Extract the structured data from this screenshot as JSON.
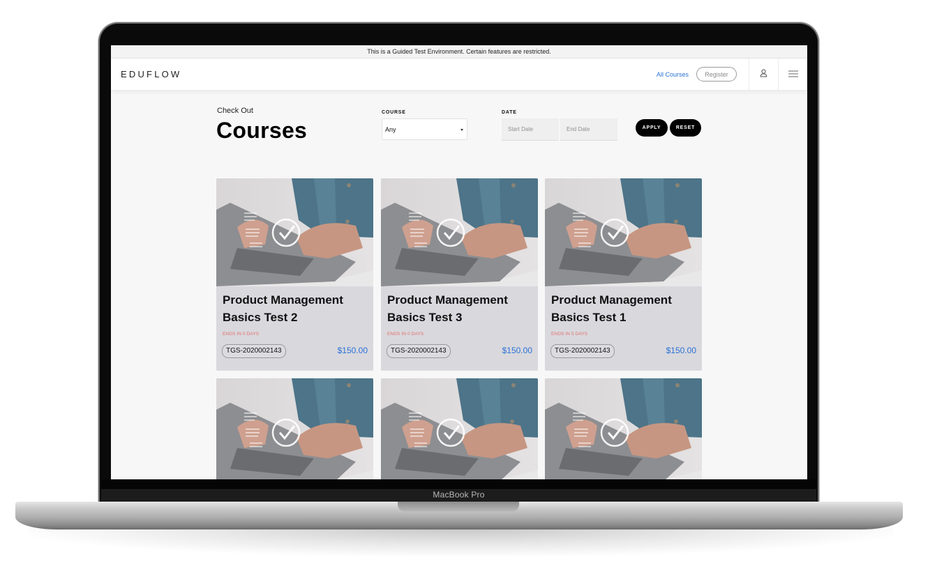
{
  "device": {
    "label": "MacBook Pro"
  },
  "banner": {
    "text": "This is a Guided Test Environment. Certain features are restricted."
  },
  "navbar": {
    "logo": "EDUFLOW",
    "links": [
      {
        "label": "All Courses"
      }
    ],
    "register_label": "Register",
    "icons": [
      "user-icon",
      "menu-icon"
    ]
  },
  "header": {
    "eyebrow": "Check Out",
    "title": "Courses"
  },
  "filters": {
    "course": {
      "label": "COURSE",
      "selected": "Any"
    },
    "date": {
      "label": "DATE",
      "start_placeholder": "Start Date",
      "end_placeholder": "End Date"
    },
    "apply_label": "APPLY",
    "reset_label": "RESET"
  },
  "colors": {
    "accent": "#2a72d6",
    "ends_text": "#e26f6f",
    "card_bg": "#d9d8dd",
    "button_bg": "#000000"
  },
  "courses": [
    {
      "title": "Product Management Basics Test 2",
      "ends": "ENDS IN 0 DAYS",
      "code": "TGS-2020002143",
      "price": "$150.00"
    },
    {
      "title": "Product Management Basics Test 3",
      "ends": "ENDS IN 0 DAYS",
      "code": "TGS-2020002143",
      "price": "$150.00"
    },
    {
      "title": "Product Management Basics Test 1",
      "ends": "ENDS IN 5 DAYS",
      "code": "TGS-2020002143",
      "price": "$150.00"
    },
    {
      "title": "",
      "ends": "",
      "code": "",
      "price": ""
    },
    {
      "title": "",
      "ends": "",
      "code": "",
      "price": ""
    },
    {
      "title": "",
      "ends": "",
      "code": "",
      "price": ""
    }
  ]
}
